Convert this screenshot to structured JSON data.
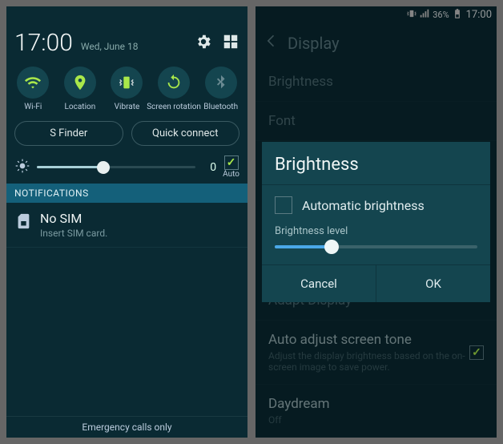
{
  "left": {
    "status_time": "17:00",
    "date": "Wed, June 18",
    "toggles": [
      {
        "label": "Wi-Fi",
        "icon": "wifi",
        "on": true
      },
      {
        "label": "Location",
        "icon": "location",
        "on": true
      },
      {
        "label": "Vibrate",
        "icon": "vibrate",
        "on": true
      },
      {
        "label": "Screen\nrotation",
        "icon": "rotation",
        "on": true
      },
      {
        "label": "Bluetooth",
        "icon": "bluetooth",
        "on": false
      }
    ],
    "pills": {
      "sfinder": "S Finder",
      "quickconnect": "Quick connect"
    },
    "brightness_value": "0",
    "brightness_pct": 42,
    "auto_label": "Auto",
    "auto_checked": true,
    "section_header": "NOTIFICATIONS",
    "notif": {
      "title": "No SIM",
      "sub": "Insert SIM card."
    },
    "footer": "Emergency calls only"
  },
  "right": {
    "statusbar": {
      "battery_pct": "36%",
      "time": "17:00"
    },
    "nav_title": "Display",
    "rows": {
      "brightness": "Brightness",
      "font": "Font",
      "adapt": "Adapt Display",
      "autotone": {
        "title": "Auto adjust screen tone",
        "sub": "Adjust the display brightness based on the on-screen image to save power.",
        "checked": true
      },
      "daydream": {
        "title": "Daydream",
        "sub": "Off"
      }
    },
    "dialog": {
      "title": "Brightness",
      "auto_label": "Automatic brightness",
      "auto_checked": false,
      "level_label": "Brightness level",
      "level_pct": 28,
      "cancel": "Cancel",
      "ok": "OK"
    }
  }
}
